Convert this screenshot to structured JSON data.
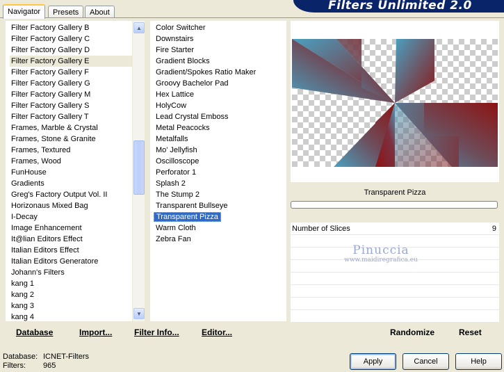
{
  "tabs": [
    "Navigator",
    "Presets",
    "About"
  ],
  "banner_title": "Filters Unlimited 2.0",
  "filters_list": [
    "Filter Factory Gallery B",
    "Filter Factory Gallery C",
    "Filter Factory Gallery D",
    "Filter Factory Gallery E",
    "Filter Factory Gallery F",
    "Filter Factory Gallery G",
    "Filter Factory Gallery M",
    "Filter Factory Gallery S",
    "Filter Factory Gallery T",
    "Frames, Marble & Crystal",
    "Frames, Stone & Granite",
    "Frames, Textured",
    "Frames, Wood",
    "FunHouse",
    "Gradients",
    "Greg's Factory Output Vol. II",
    "Horizonaus Mixed Bag",
    "I-Decay",
    "Image Enhancement",
    "It@lian Editors Effect",
    "Italian Editors Effect",
    "Italian Editors Generatore",
    "Johann's Filters",
    "kang 1",
    "kang 2",
    "kang 3",
    "kang 4"
  ],
  "filters_selected_index": 3,
  "effects_list": [
    "Color Switcher",
    "Downstairs",
    "Fire Starter",
    "Gradient Blocks",
    "Gradient/Spokes Ratio Maker",
    "Groovy Bachelor Pad",
    "Hex Lattice",
    "HolyCow",
    "Lead Crystal Emboss",
    "Metal Peacocks",
    "Metalfalls",
    "Mo' Jellyfish",
    "Oscilloscope",
    "Perforator 1",
    "Splash 2",
    "The Stump 2",
    "Transparent Bullseye",
    "Transparent Pizza",
    "Warm Cloth",
    "Zebra Fan"
  ],
  "effects_selected_index": 17,
  "effect_title": "Transparent Pizza",
  "params": [
    {
      "label": "Number of Slices",
      "value": "9"
    }
  ],
  "watermark": {
    "name": "Pinuccia",
    "url": "www.maidiregrafica.eu"
  },
  "left_bar": {
    "database": "Database",
    "import": "Import...",
    "filter_info": "Filter Info...",
    "editor": "Editor..."
  },
  "right_bar": {
    "randomize": "Randomize",
    "reset": "Reset"
  },
  "status": {
    "database_label": "Database:",
    "database_value": "ICNET-Filters",
    "filters_label": "Filters:",
    "filters_value": "965"
  },
  "dialog": {
    "apply": "Apply",
    "cancel": "Cancel",
    "help": "Help"
  },
  "colors": {
    "selection": "#316ac5",
    "dialog_bg": "#ece9d8",
    "banner": "#0a246a",
    "preview_red": "#8c1414",
    "preview_teal": "#4aa0c0"
  }
}
